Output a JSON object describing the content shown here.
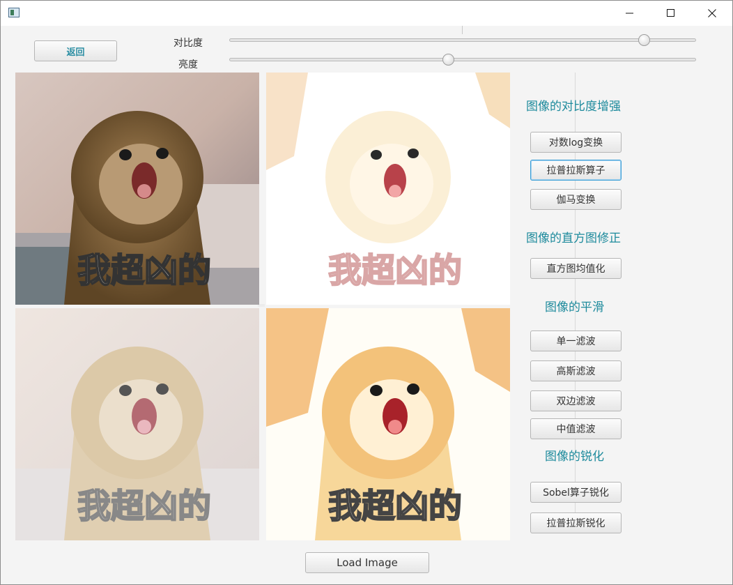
{
  "window": {
    "title": ""
  },
  "controls": {
    "back_label": "返回",
    "contrast_label": "对比度",
    "brightness_label": "亮度",
    "contrast_value": 0.89,
    "brightness_value": 0.47,
    "load_label": "Load Image"
  },
  "images": {
    "caption": "我超凶的"
  },
  "sidebar": {
    "contrast_section": "图像的对比度增强",
    "log_label": "对数log变换",
    "laplacian_label": "拉普拉斯算子",
    "gamma_label": "伽马变换",
    "histogram_section": "图像的直方图修正",
    "histeq_label": "直方图均值化",
    "smoothing_section": "图像的平滑",
    "single_filter_label": "单一滤波",
    "gaussian_filter_label": "高斯滤波",
    "bilateral_filter_label": "双边滤波",
    "median_filter_label": "中值滤波",
    "sharpen_section": "图像的锐化",
    "sobel_label": "Sobel算子锐化",
    "laplacian_sharpen_label": "拉普拉斯锐化"
  },
  "colors": {
    "accent": "#1d8a9c",
    "back_text": "#2b8ea3",
    "focus": "#3d9fd6"
  }
}
